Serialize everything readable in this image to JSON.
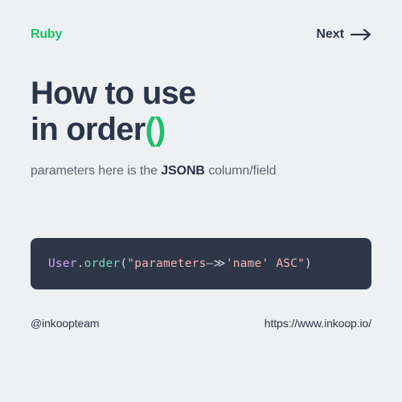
{
  "header": {
    "tag": "Ruby",
    "next_label": "Next"
  },
  "title": {
    "line1": "How to use",
    "line2": "in order",
    "parens": "()"
  },
  "subtitle": {
    "pre": "parameters here is the ",
    "bold": "JSONB",
    "post": " column/field"
  },
  "code": {
    "class": "User",
    "dot": ".",
    "method": "order",
    "open_paren": "(",
    "str_open": "\"parameters",
    "arrow": "—≫",
    "str_close": "'name' ASC\"",
    "close_paren": ")"
  },
  "footer": {
    "handle": "@inkoopteam",
    "url": "https://www.inkoop.io/"
  }
}
